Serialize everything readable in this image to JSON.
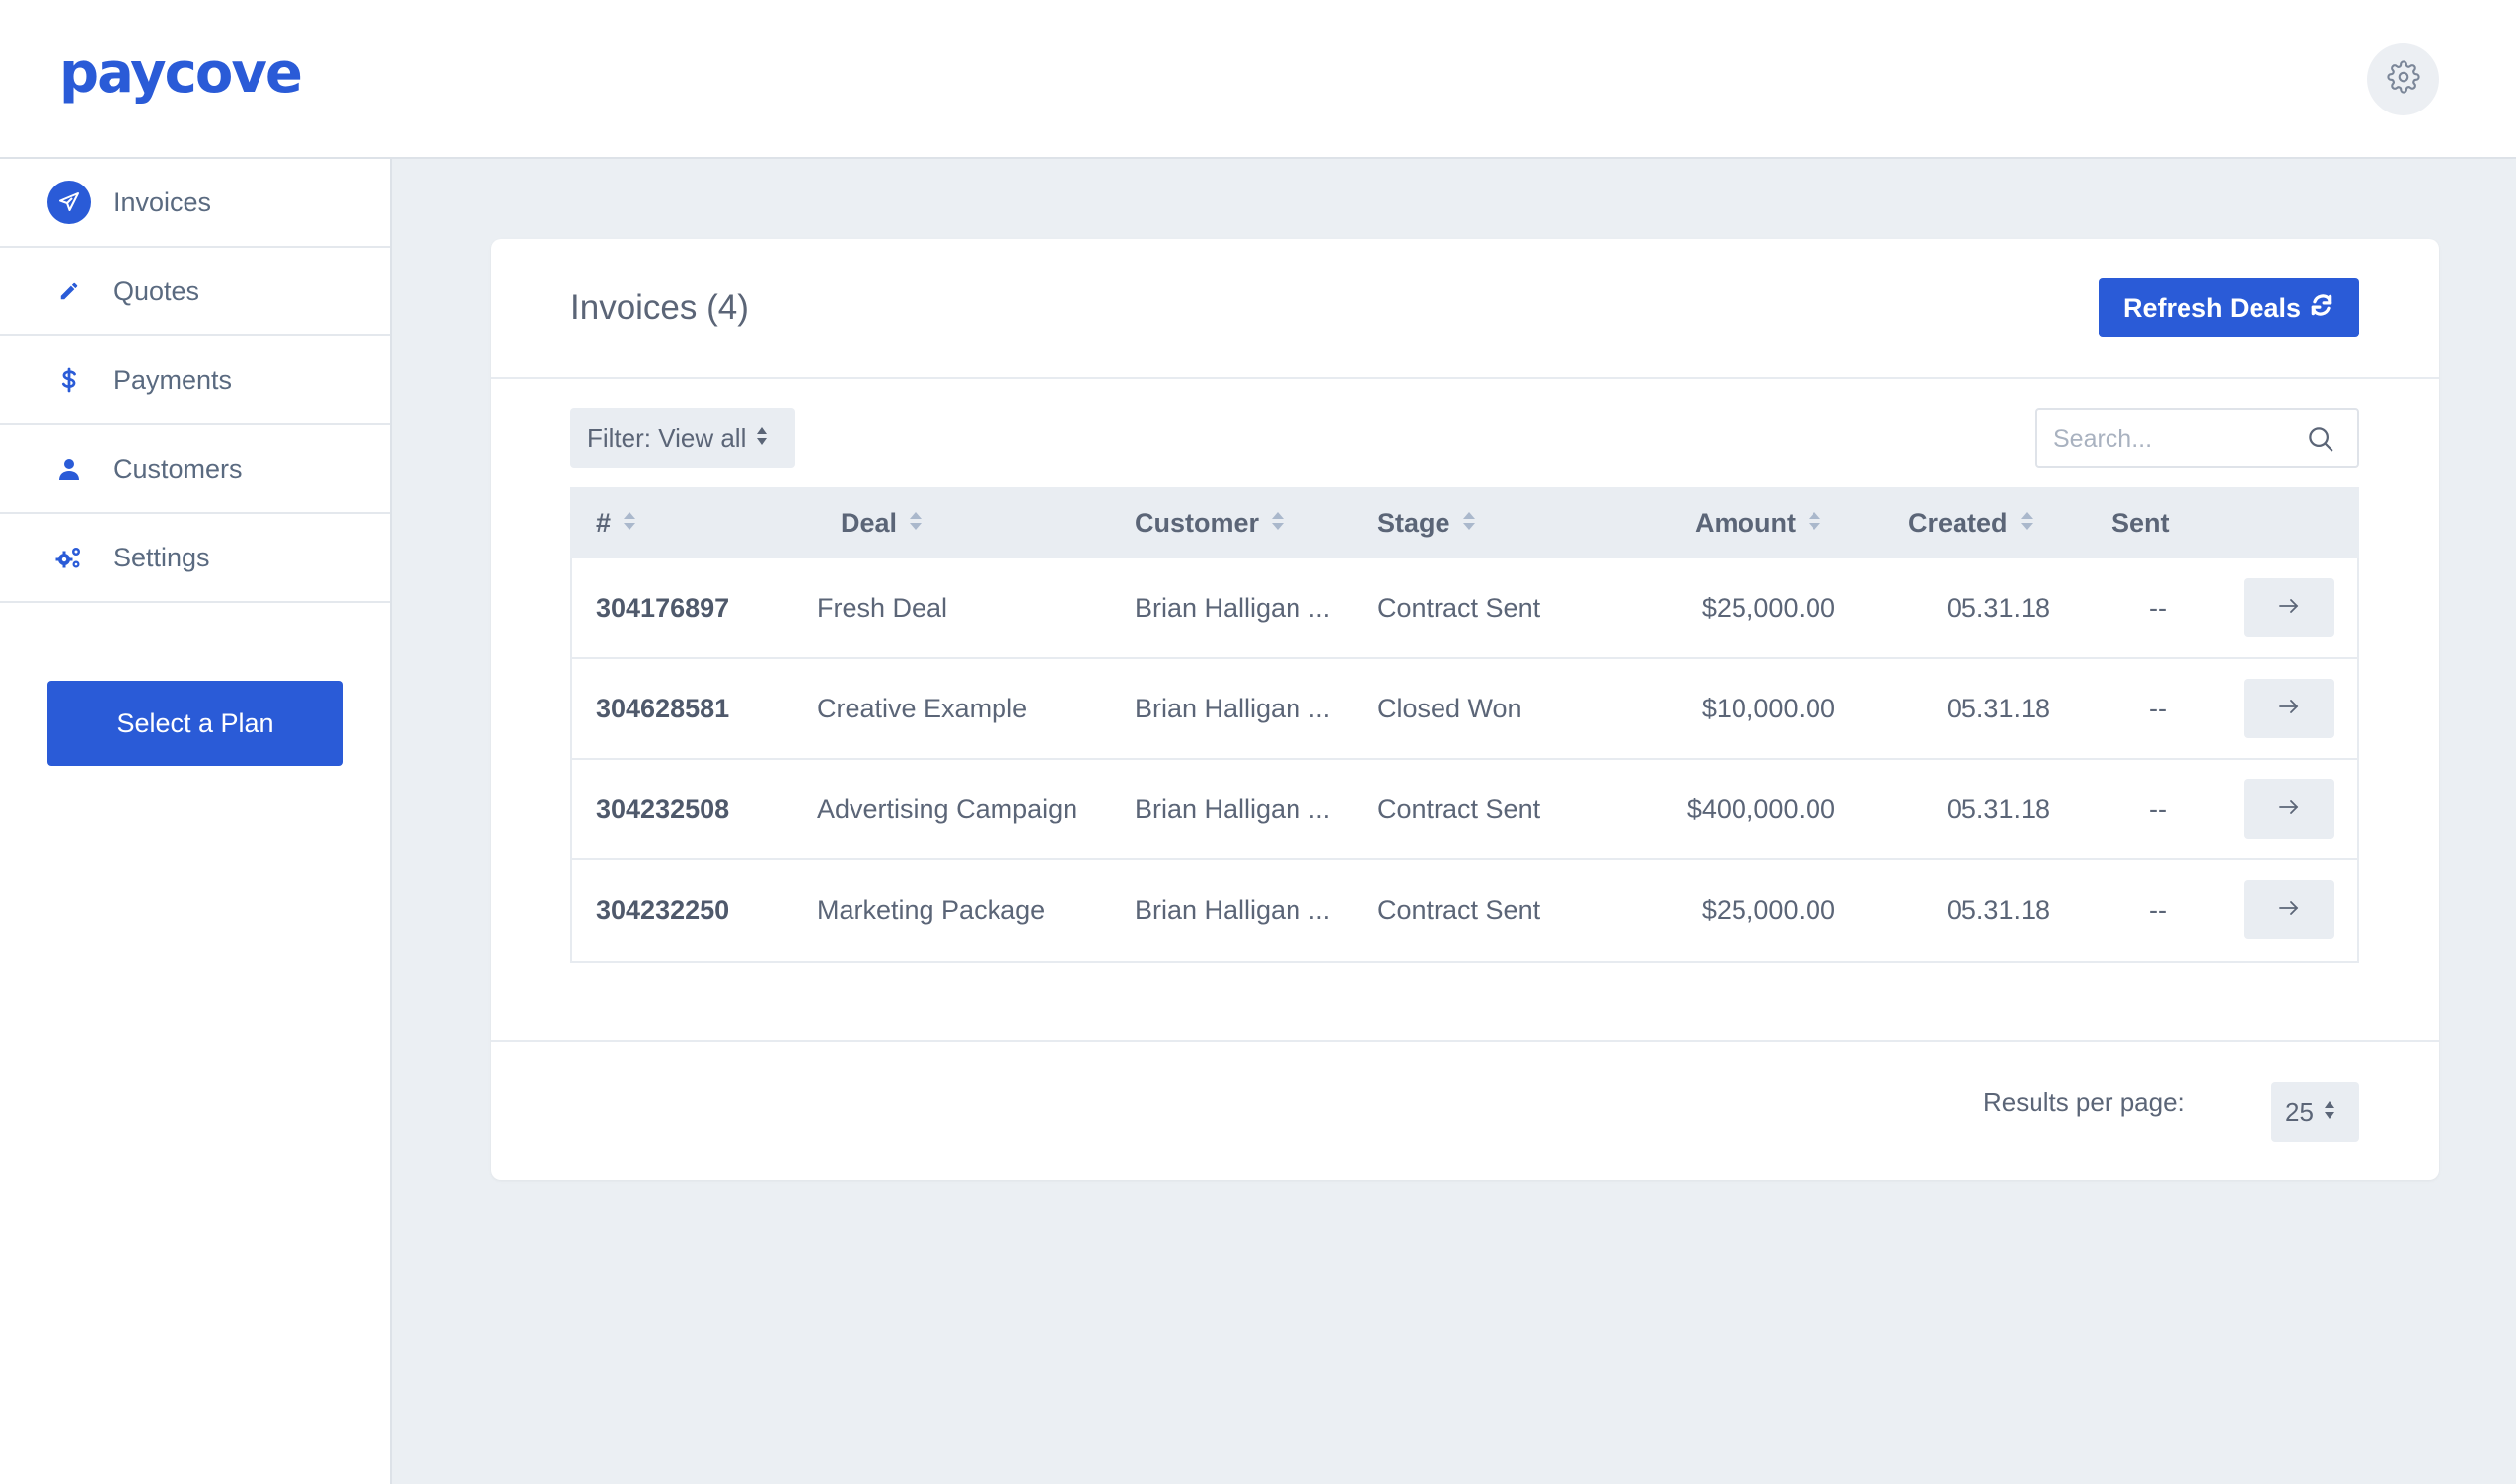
{
  "app": {
    "logo": "paycove"
  },
  "header": {
    "settings_icon": "gear-icon"
  },
  "sidebar": {
    "items": [
      {
        "label": "Invoices",
        "icon": "paper-plane-icon",
        "active": true
      },
      {
        "label": "Quotes",
        "icon": "pencil-icon",
        "active": false
      },
      {
        "label": "Payments",
        "icon": "dollar-icon",
        "active": false
      },
      {
        "label": "Customers",
        "icon": "user-icon",
        "active": false
      },
      {
        "label": "Settings",
        "icon": "cogs-icon",
        "active": false
      }
    ],
    "plan_button": "Select a Plan"
  },
  "main": {
    "title": "Invoices (4)",
    "refresh_button": "Refresh Deals",
    "filter": {
      "value": "Filter: View all"
    },
    "search": {
      "placeholder": "Search..."
    },
    "table": {
      "columns": [
        "#",
        "Deal",
        "Customer",
        "Stage",
        "Amount",
        "Created",
        "Sent"
      ],
      "rows": [
        {
          "id": "304176897",
          "deal": "Fresh Deal",
          "customer": "Brian Halligan ...",
          "stage": "Contract Sent",
          "amount": "$25,000.00",
          "created": "05.31.18",
          "sent": "--"
        },
        {
          "id": "304628581",
          "deal": "Creative Example",
          "customer": "Brian Halligan ...",
          "stage": "Closed Won",
          "amount": "$10,000.00",
          "created": "05.31.18",
          "sent": "--"
        },
        {
          "id": "304232508",
          "deal": "Advertising Campaign",
          "customer": "Brian Halligan ...",
          "stage": "Contract Sent",
          "amount": "$400,000.00",
          "created": "05.31.18",
          "sent": "--"
        },
        {
          "id": "304232250",
          "deal": "Marketing Package",
          "customer": "Brian Halligan ...",
          "stage": "Contract Sent",
          "amount": "$25,000.00",
          "created": "05.31.18",
          "sent": "--"
        }
      ]
    },
    "pagination": {
      "label": "Results per page:",
      "value": "25"
    }
  },
  "colors": {
    "accent": "#2a5bd7",
    "background": "#ebeff3",
    "text": "#5b6577"
  }
}
